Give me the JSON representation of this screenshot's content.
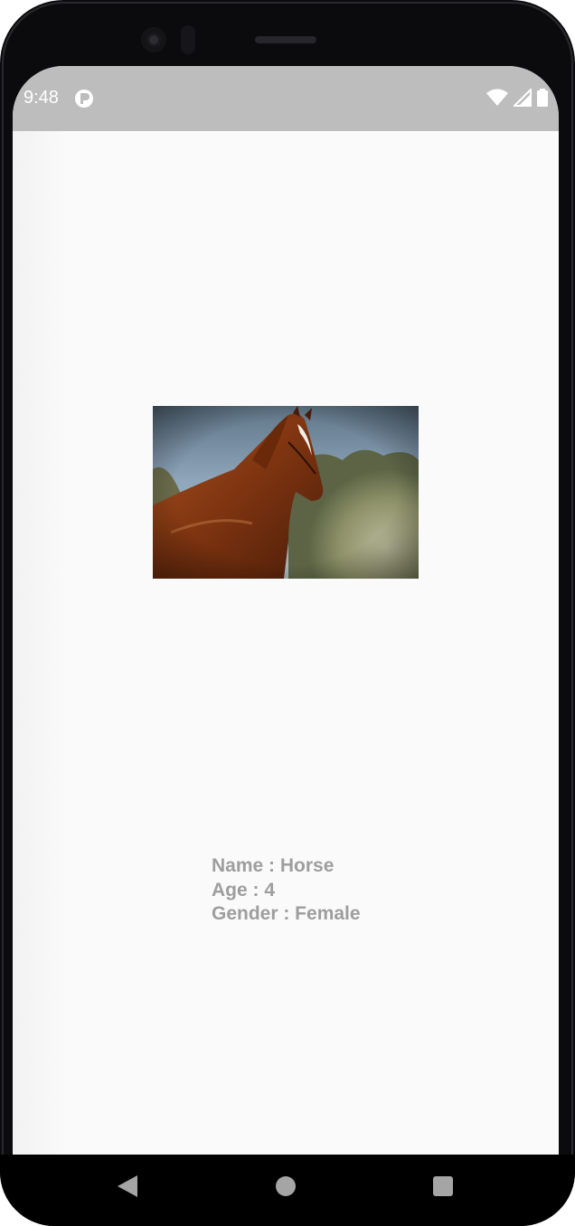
{
  "status_bar": {
    "time": "9:48",
    "app_icon": "app-notification-icon",
    "icons": [
      "wifi-icon",
      "cellular-signal-icon",
      "battery-icon"
    ]
  },
  "pet": {
    "image_icon": "horse-photo",
    "name_line": "Name : Horse",
    "age_line": "Age : 4",
    "gender_line": "Gender : Female"
  },
  "navigation": {
    "items": [
      "back-icon",
      "home-icon",
      "recents-icon"
    ]
  },
  "colors": {
    "status_bar_bg": "#bdbdbd",
    "screen_bg": "#fafafa",
    "info_text": "#9e9e9e",
    "nav_bg": "#000000"
  }
}
